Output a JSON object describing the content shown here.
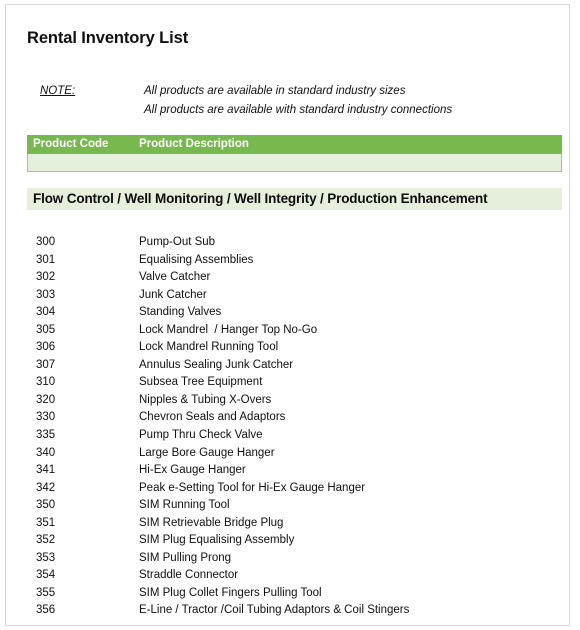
{
  "document": {
    "title": "Rental Inventory List"
  },
  "note": {
    "label": "NOTE:",
    "lines": [
      "All products are available in standard industry sizes",
      "All products are available with standard industry connections"
    ]
  },
  "table": {
    "headers": {
      "code": "Product Code",
      "description": "Product Description"
    },
    "blank_row": "",
    "section_heading": "Flow Control / Well Monitoring / Well Integrity / Production Enhancement",
    "rows": [
      {
        "code": "300",
        "description": "Pump-Out Sub"
      },
      {
        "code": "301",
        "description": "Equalising Assemblies"
      },
      {
        "code": "302",
        "description": "Valve Catcher"
      },
      {
        "code": "303",
        "description": "Junk Catcher"
      },
      {
        "code": "304",
        "description": "Standing Valves"
      },
      {
        "code": "305",
        "description": "Lock Mandrel  / Hanger Top No-Go"
      },
      {
        "code": "306",
        "description": "Lock Mandrel Running Tool"
      },
      {
        "code": "307",
        "description": "Annulus Sealing Junk Catcher"
      },
      {
        "code": "310",
        "description": "Subsea Tree Equipment"
      },
      {
        "code": "320",
        "description": "Nipples & Tubing X-Overs"
      },
      {
        "code": "330",
        "description": "Chevron Seals and Adaptors"
      },
      {
        "code": "335",
        "description": "Pump Thru Check Valve"
      },
      {
        "code": "340",
        "description": "Large Bore Gauge Hanger"
      },
      {
        "code": "341",
        "description": "Hi-Ex Gauge Hanger"
      },
      {
        "code": "342",
        "description": "Peak e-Setting Tool for Hi-Ex Gauge Hanger"
      },
      {
        "code": "350",
        "description": "SIM Running Tool"
      },
      {
        "code": "351",
        "description": "SIM Retrievable Bridge Plug"
      },
      {
        "code": "352",
        "description": "SIM Plug Equalising Assembly"
      },
      {
        "code": "353",
        "description": "SIM Pulling Prong"
      },
      {
        "code": "354",
        "description": "Straddle Connector"
      },
      {
        "code": "355",
        "description": "SIM Plug Collet Fingers Pulling Tool"
      },
      {
        "code": "356",
        "description": "E-Line / Tractor /Coil Tubing Adaptors & Coil Stingers"
      }
    ]
  },
  "colors": {
    "header_green": "#77b94f",
    "light_green": "#e5f0dc",
    "band_green": "#e6efdc",
    "text": "#101010",
    "page_border": "#d8d8d8"
  }
}
